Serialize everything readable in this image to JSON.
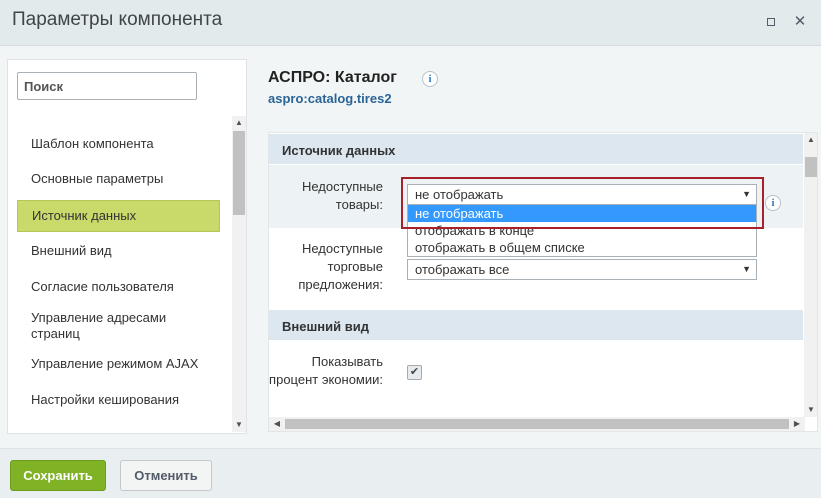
{
  "window": {
    "title": "Параметры компонента"
  },
  "sidebar": {
    "search_placeholder": "Поиск",
    "items": [
      {
        "label": "Шаблон компонента"
      },
      {
        "label": "Основные параметры"
      },
      {
        "label": "Источник данных",
        "active": true
      },
      {
        "label": "Внешний вид"
      },
      {
        "label": "Согласие пользователя"
      },
      {
        "label": "Управление адресами страниц"
      },
      {
        "label": "Управление режимом AJAX"
      },
      {
        "label": "Настройки кеширования"
      }
    ]
  },
  "component": {
    "title": "АСПРО: Каталог",
    "code": "aspro:catalog.tires2"
  },
  "sections": {
    "data_source": "Источник данных",
    "appearance": "Внешний вид"
  },
  "fields": {
    "unavailable_goods": {
      "label_line1": "Недоступные",
      "label_line2": "товары:",
      "value": "не отображать",
      "options": [
        "не отображать",
        "отображать в конце",
        "отображать в общем списке"
      ],
      "highlighted_option": "не отображать"
    },
    "unavailable_offers": {
      "label_line1": "Недоступные",
      "label_line2": "торговые",
      "label_line3": "предложения:",
      "value": "отображать все"
    },
    "show_discount_percent": {
      "label_line1": "Показывать",
      "label_line2": "процент экономии:",
      "checked": true
    }
  },
  "footer": {
    "save_label": "Сохранить",
    "cancel_label": "Отменить"
  },
  "colors": {
    "accent_green": "#7fb325",
    "active_nav": "#c9d96a",
    "highlight_border": "#a8202a",
    "selected_option": "#3399ff"
  }
}
